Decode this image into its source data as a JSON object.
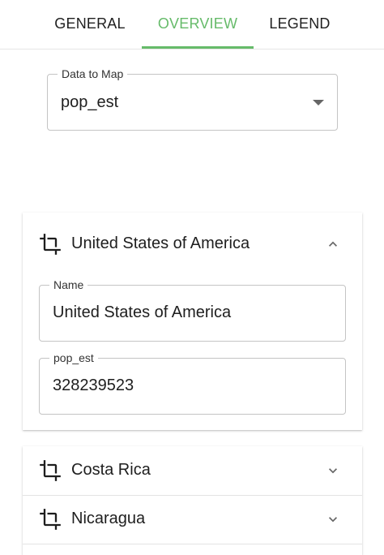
{
  "tabs": [
    {
      "label": "GENERAL",
      "active": false
    },
    {
      "label": "OVERVIEW",
      "active": true
    },
    {
      "label": "LEGEND",
      "active": false
    }
  ],
  "data_select": {
    "label": "Data to Map",
    "value": "pop_est"
  },
  "expanded_item": {
    "title": "United States of America",
    "fields": [
      {
        "label": "Name",
        "value": "United States of America"
      },
      {
        "label": "pop_est",
        "value": "328239523"
      }
    ]
  },
  "items": [
    {
      "title": "Costa Rica"
    },
    {
      "title": "Nicaragua"
    }
  ],
  "colors": {
    "accent": "#66bb6a",
    "border": "#c4c4c4"
  },
  "icons": {
    "item_icon": "crop-icon",
    "expand": "chevron-down-icon",
    "collapse": "chevron-up-icon",
    "select": "caret-down-icon"
  }
}
